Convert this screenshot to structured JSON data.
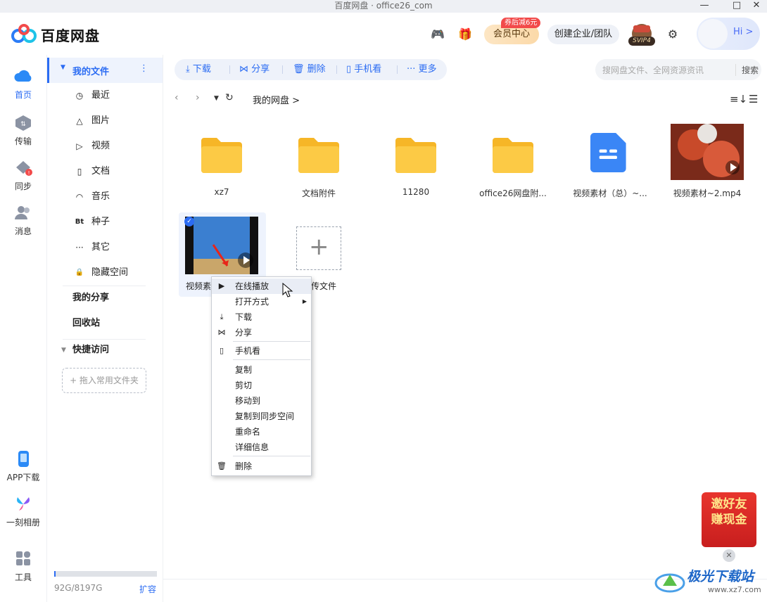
{
  "window": {
    "title": "百度网盘 · office26_com"
  },
  "header": {
    "brand": "百度网盘",
    "vip_label": "会员中心",
    "vip_promo": "券后减6元",
    "team_label": "创建企业/团队",
    "svip_label": "SVIP4",
    "greeting": "Hi >"
  },
  "rail": {
    "items": [
      "首页",
      "传输",
      "同步",
      "消息"
    ],
    "bottom": [
      "APP下载",
      "一刻相册",
      "工具"
    ]
  },
  "sidebar": {
    "my_files": "我的文件",
    "items": [
      "最近",
      "图片",
      "视频",
      "文档",
      "音乐",
      "种子",
      "其它",
      "隐藏空间"
    ],
    "item_icons": [
      "◷",
      "△",
      "▷",
      "▯",
      "◠",
      "Bt",
      "···",
      "🔒"
    ],
    "my_share": "我的分享",
    "recycle": "回收站",
    "quick_access": "快捷访问",
    "drop_folder": "+ 拖入常用文件夹",
    "quota": "92G/8197G",
    "expand": "扩容",
    "quota_fraction": 0.011
  },
  "toolbar": {
    "download": "下载",
    "share": "分享",
    "delete": "删除",
    "phone_view": "手机看",
    "more": "更多",
    "search_placeholder": "搜网盘文件、全网资源资讯",
    "search_button": "搜索"
  },
  "nav": {
    "breadcrumb": "我的网盘 >"
  },
  "files": [
    {
      "name": "xz7",
      "type": "folder"
    },
    {
      "name": "文档附件",
      "type": "folder"
    },
    {
      "name": "11280",
      "type": "folder"
    },
    {
      "name": "office26网盘附...",
      "type": "folder"
    },
    {
      "name": "视频素材（总）~...",
      "type": "doc"
    },
    {
      "name": "视频素材~2.mp4",
      "type": "video"
    }
  ],
  "selected_file": {
    "name": "视频素"
  },
  "upload_tile": {
    "label": "传文件"
  },
  "context_menu": {
    "items": [
      "在线播放",
      "打开方式",
      "下载",
      "分享",
      "手机看",
      "复制",
      "剪切",
      "移动到",
      "复制到同步空间",
      "重命名",
      "详细信息",
      "删除"
    ]
  },
  "promo": {
    "line1": "邀好友",
    "line2": "赚现金"
  },
  "watermark": {
    "text": "极光下载站",
    "url": "www.xz7.com"
  },
  "colors": {
    "accent": "#2b6cf3",
    "folder": "#f9c33b",
    "promo": "#e8352d"
  }
}
